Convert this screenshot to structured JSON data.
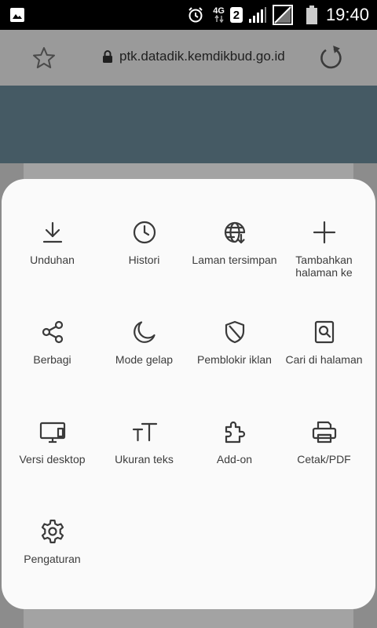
{
  "status_bar": {
    "network": "4G",
    "sim_slot": "2",
    "time": "19:40",
    "icons": [
      "image-icon",
      "alarm-icon",
      "signal-icon",
      "no-signal-icon",
      "battery-icon"
    ]
  },
  "address_bar": {
    "url": "ptk.datadik.kemdikbud.go.id",
    "icons": [
      "star-icon",
      "lock-icon",
      "reload-icon"
    ]
  },
  "menu": {
    "items": [
      {
        "label": "Unduhan",
        "icon": "download-icon"
      },
      {
        "label": "Histori",
        "icon": "clock-icon"
      },
      {
        "label": "Laman tersimpan",
        "icon": "globe-download-icon"
      },
      {
        "label": "Tambahkan halaman ke",
        "icon": "plus-icon"
      },
      {
        "label": "Berbagi",
        "icon": "share-icon"
      },
      {
        "label": "Mode gelap",
        "icon": "moon-icon"
      },
      {
        "label": "Pemblokir iklan",
        "icon": "shield-icon"
      },
      {
        "label": "Cari di halaman",
        "icon": "find-in-page-icon"
      },
      {
        "label": "Versi desktop",
        "icon": "desktop-icon"
      },
      {
        "label": "Ukuran teks",
        "icon": "text-size-icon"
      },
      {
        "label": "Add-on",
        "icon": "puzzle-icon"
      },
      {
        "label": "Cetak/PDF",
        "icon": "printer-icon"
      },
      {
        "label": "Pengaturan",
        "icon": "gear-icon"
      }
    ]
  }
}
